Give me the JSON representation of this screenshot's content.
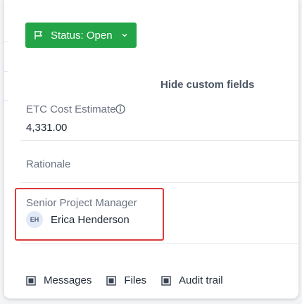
{
  "header": {
    "status_label": "Status: Open"
  },
  "custom_fields": {
    "hide_label": "Hide custom fields",
    "etc_cost_estimate": {
      "label": "ETC Cost Estimate",
      "value": "4,331.00"
    },
    "rationale": {
      "label": "Rationale"
    },
    "senior_project_manager": {
      "label": "Senior Project Manager",
      "avatar_initials": "EH",
      "value": "Erica Henderson"
    }
  },
  "tabs": [
    {
      "label": "Messages"
    },
    {
      "label": "Files"
    },
    {
      "label": "Audit trail"
    }
  ],
  "colors": {
    "status_button": "#22a447",
    "highlight_border": "#dc3b3b"
  },
  "icons": {
    "status": "flag-icon",
    "status_dropdown": "chevron-down-icon",
    "info": "info-icon",
    "tab": "square-checkbox-icon"
  }
}
